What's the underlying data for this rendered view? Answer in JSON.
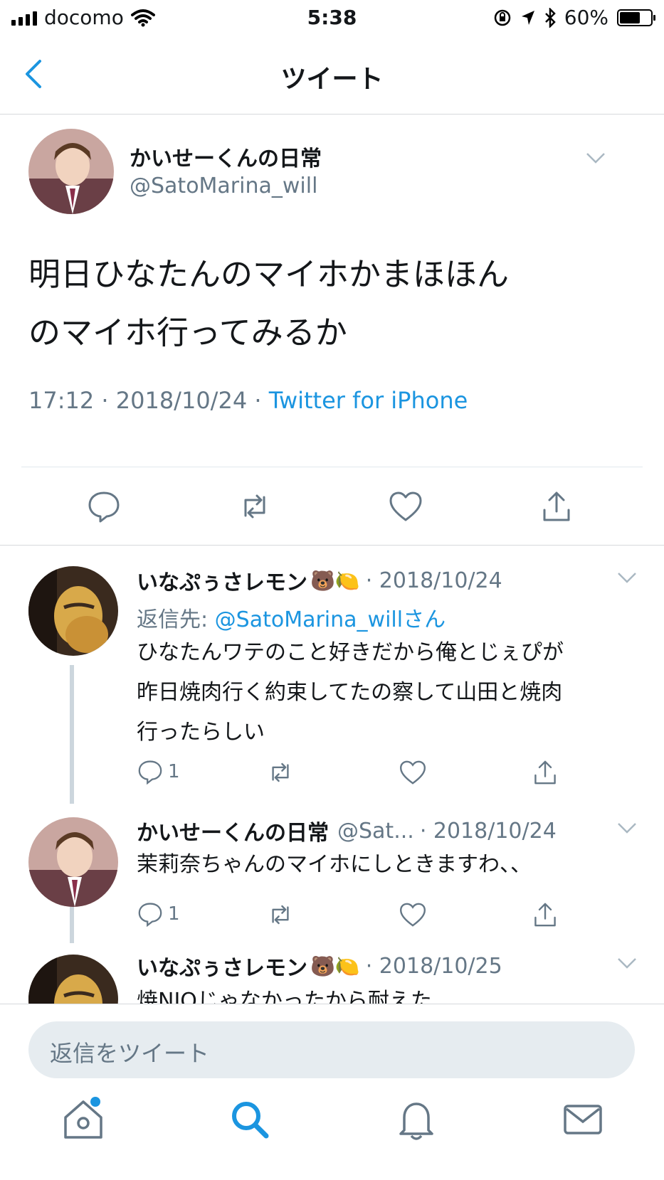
{
  "status_bar": {
    "carrier": "docomo",
    "time": "5:38",
    "battery": "60%"
  },
  "nav": {
    "title": "ツイート"
  },
  "tweet": {
    "name": "かいせーくんの日常",
    "handle": "@SatoMarina_will",
    "text_line1": "明日ひなたんのマイホかまほほん",
    "text_line2": "のマイホ行ってみるか",
    "time": "17:12 · 2018/10/24 · ",
    "source": "Twitter for iPhone"
  },
  "replies": [
    {
      "name": "いなぷぅさレモン",
      "emojis": "🐻🍋",
      "date": "· 2018/10/24",
      "reply_to_prefix": "返信先: ",
      "reply_to_handle": "@SatoMarina_willさん",
      "text_line1": "ひなたんワテのこと好きだから俺とじぇぴが",
      "text_line2": "昨日焼肉行く約束してたの察して山田と焼肉",
      "text_line3": "行ったらしい",
      "reply_count": "1"
    },
    {
      "name": "かいせーくんの日常",
      "handle": "@Sat...",
      "date": "· 2018/10/24",
      "text_line1": "茉莉奈ちゃんのマイホにしときますわ、、",
      "reply_count": "1"
    },
    {
      "name": "いなぷぅさレモン",
      "emojis": "🐻🍋",
      "date": "· 2018/10/25",
      "text_line1": "焼NIOじゃなかったから耐えた"
    }
  ],
  "composer": {
    "placeholder": "返信をツイート"
  },
  "colors": {
    "accent": "#1b95e0",
    "secondary_text": "#657786",
    "divider": "#e1e8ed"
  },
  "icons": [
    "back-chevron-icon",
    "reply-icon",
    "retweet-icon",
    "like-icon",
    "share-icon",
    "home-icon",
    "search-icon",
    "notifications-icon",
    "messages-icon"
  ]
}
